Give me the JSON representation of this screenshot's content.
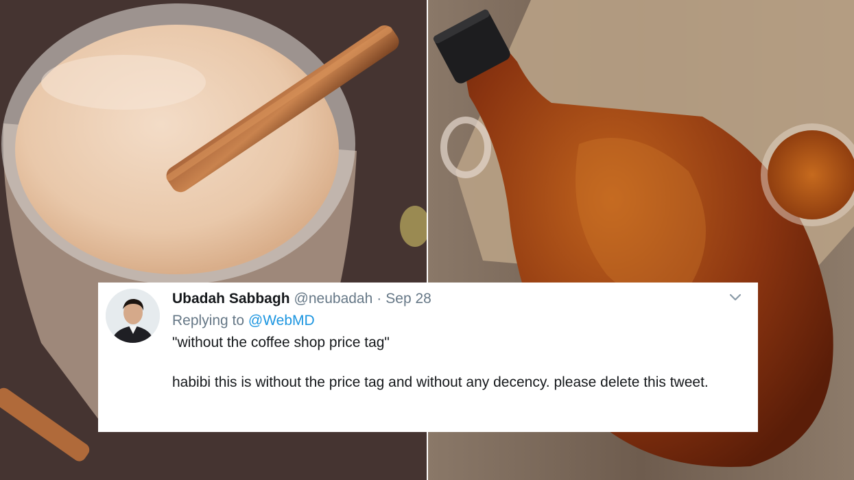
{
  "tweet": {
    "author_name": "Ubadah Sabbagh",
    "author_handle": "@neubadah",
    "separator": "·",
    "date": "Sep 28",
    "reply_prefix": "Replying to",
    "reply_handle": "@WebMD",
    "quote_text": "\"without the coffee shop price tag\"",
    "body_text": "habibi this is without the price tag and without any decency. please delete this tweet."
  },
  "icons": {
    "more_options": "chevron-down-icon",
    "avatar": "user-avatar"
  },
  "colors": {
    "name": "#14171a",
    "secondary": "#657786",
    "link": "#1b95e0",
    "card_background": "#ffffff"
  }
}
